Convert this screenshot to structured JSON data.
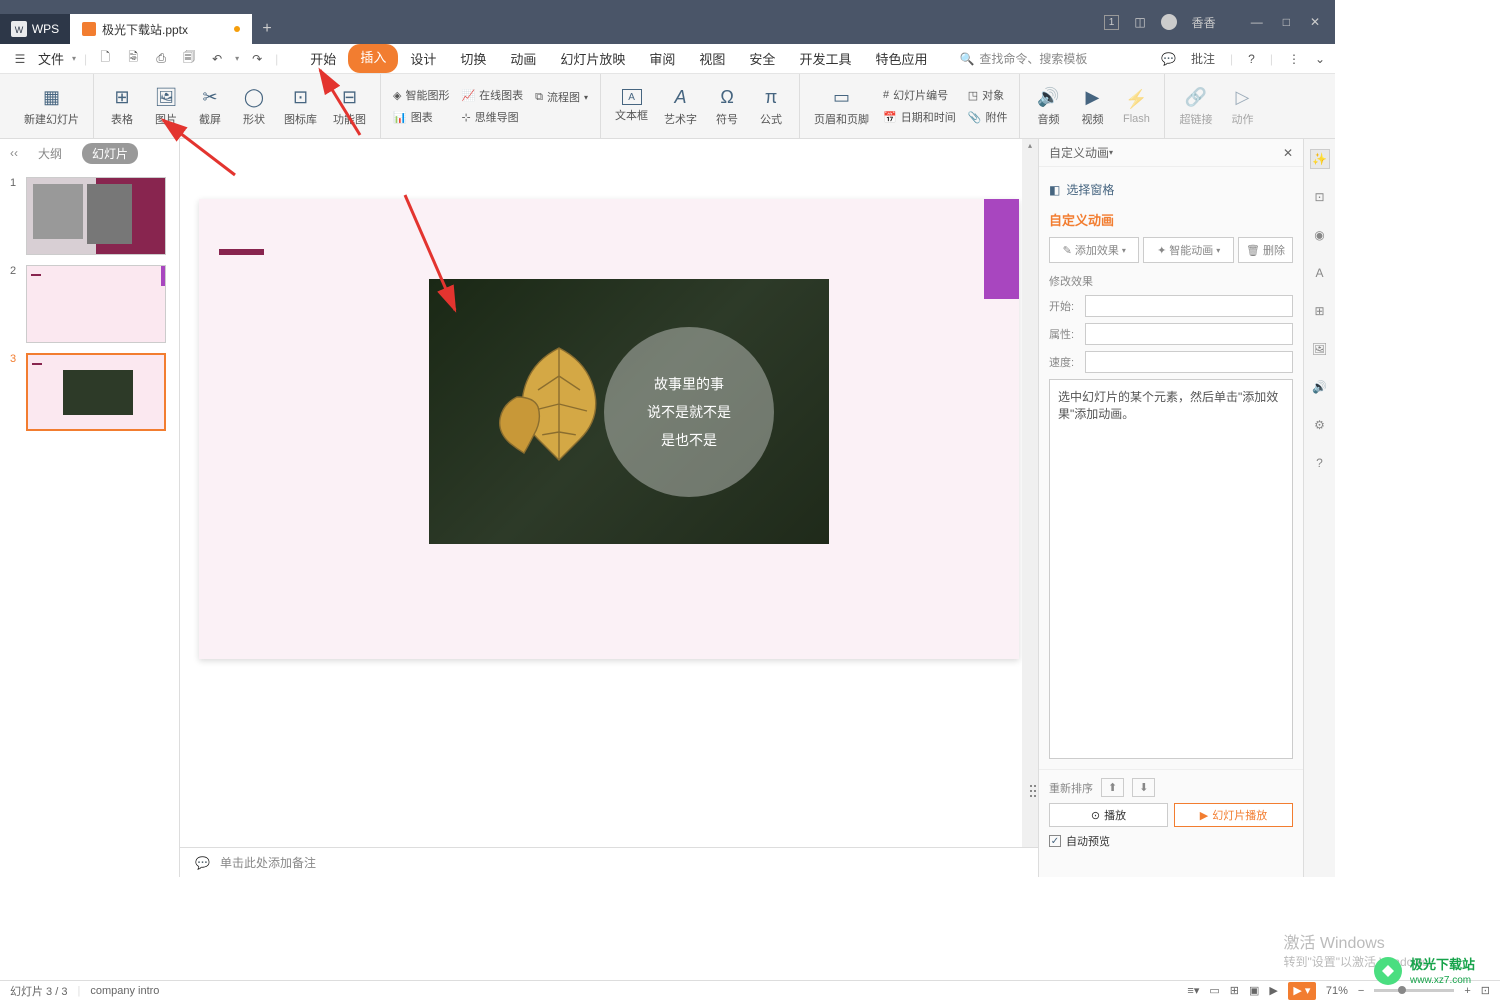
{
  "titlebar": {
    "wps": "WPS",
    "filename": "极光下载站.pptx",
    "user": "香香"
  },
  "menubar": {
    "file": "文件",
    "tabs": [
      "开始",
      "插入",
      "设计",
      "切换",
      "动画",
      "幻灯片放映",
      "审阅",
      "视图",
      "安全",
      "开发工具",
      "特色应用"
    ],
    "activeTab": 1,
    "search": "查找命令、搜索模板",
    "comment": "批注"
  },
  "ribbon": {
    "newSlide": "新建幻灯片",
    "table": "表格",
    "image": "图片",
    "screenshot": "截屏",
    "shapes": "形状",
    "iconLib": "图标库",
    "funcChart": "功能图",
    "smartArt": "智能图形",
    "onlineChart": "在线图表",
    "chart": "图表",
    "flowChart": "流程图",
    "mindMap": "思维导图",
    "textBox": "文本框",
    "wordArt": "艺术字",
    "symbol": "符号",
    "formula": "公式",
    "headerFooter": "页眉和页脚",
    "slideNum": "幻灯片编号",
    "dateTime": "日期和时间",
    "object": "对象",
    "attachment": "附件",
    "audio": "音频",
    "video": "视频",
    "flash": "Flash",
    "hyperlink": "超链接",
    "action": "动作"
  },
  "slidePanel": {
    "collapse": "‹‹",
    "outline": "大纲",
    "slides": "幻灯片",
    "thumbs": [
      1,
      2,
      3
    ],
    "selected": 3
  },
  "canvas": {
    "line1": "故事里的事",
    "line2": "说不是就不是",
    "line3": "是也不是",
    "notesPlaceholder": "单击此处添加备注"
  },
  "rightPanel": {
    "title": "自定义动画",
    "selectPane": "选择窗格",
    "sectionTitle": "自定义动画",
    "addEffect": "添加效果",
    "smartAnim": "智能动画",
    "delete": "删除",
    "modifyEffect": "修改效果",
    "start": "开始:",
    "property": "属性:",
    "speed": "速度:",
    "hint": "选中幻灯片的某个元素，然后单击\"添加效果\"添加动画。",
    "reorder": "重新排序",
    "play": "播放",
    "slideshow": "幻灯片播放",
    "autoPreview": "自动预览"
  },
  "statusbar": {
    "slideInfo": "幻灯片 3 / 3",
    "template": "company intro",
    "zoom": "71%"
  },
  "watermark": {
    "line1": "激活 Windows",
    "line2": "转到\"设置\"以激活 Windows。",
    "logo": "极光下载站",
    "url": "www.xz7.com"
  }
}
